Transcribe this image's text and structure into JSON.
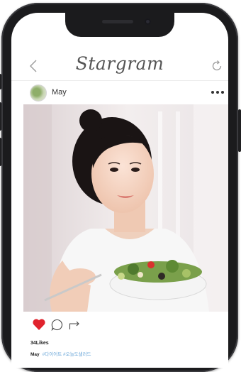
{
  "app": {
    "title": "Stargram"
  },
  "post": {
    "username": "May",
    "likes": "34Likes",
    "caption_user": "May",
    "hashtags": "#다이어트 #오늘도샐러드",
    "liked": true
  },
  "icons": {
    "back": "chevron-left-icon",
    "refresh": "refresh-icon",
    "more": "more-horizontal-icon",
    "like": "heart-icon",
    "comment": "comment-icon",
    "share": "share-icon"
  },
  "colors": {
    "like": "#e0232d",
    "hashtag": "#6aa6d8",
    "phone_frame": "#1b1b1d"
  }
}
